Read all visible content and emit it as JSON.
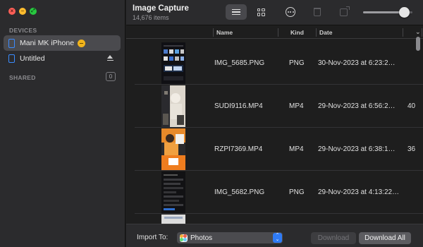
{
  "window": {
    "title": "Image Capture",
    "subtitle": "14,676 items"
  },
  "sidebar": {
    "devices_label": "DEVICES",
    "devices": [
      {
        "label": "Mani MK iPhone",
        "selected": true
      },
      {
        "label": "Untitled",
        "selected": false
      }
    ],
    "shared_label": "SHARED",
    "shared_count": "0"
  },
  "toolbar": {
    "thumbnail_size": 0.83,
    "icons": [
      "list-view-icon",
      "grid-view-icon",
      "more-options-icon",
      "trash-icon",
      "rotate-icon"
    ]
  },
  "table": {
    "columns": [
      "Name",
      "Kind",
      "Date"
    ],
    "rows": [
      {
        "name": "IMG_5685.PNG",
        "kind": "PNG",
        "date": "30-Nov-2023 at 6:23:2…",
        "size": ""
      },
      {
        "name": "SUDI9116.MP4",
        "kind": "MP4",
        "date": "29-Nov-2023 at 6:56:2…",
        "size": "40"
      },
      {
        "name": "RZPI7369.MP4",
        "kind": "MP4",
        "date": "29-Nov-2023 at 6:38:1…",
        "size": "36"
      },
      {
        "name": "IMG_5682.PNG",
        "kind": "PNG",
        "date": "29-Nov-2023 at 4:13:22…",
        "size": ""
      }
    ]
  },
  "footer": {
    "import_to_label": "Import To:",
    "import_to_value": "Photos",
    "download_label": "Download",
    "download_all_label": "Download All"
  },
  "colors": {
    "accent": "#2f7bf6",
    "device_icon": "#3b8cff",
    "busy_badge": "#f2b41b"
  }
}
